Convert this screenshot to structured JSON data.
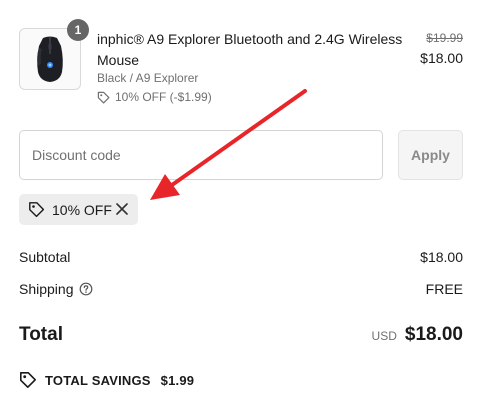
{
  "product": {
    "quantity": "1",
    "name": "inphic® A9 Explorer Bluetooth and 2.4G Wireless Mouse",
    "variant": "Black / A9 Explorer",
    "discount": "10% OFF (-$1.99)",
    "original_price": "$19.99",
    "price": "$18.00",
    "thumbnail_icon": "mouse-icon"
  },
  "discount_code": {
    "placeholder": "Discount code",
    "value": "",
    "apply_label": "Apply"
  },
  "applied_discount": {
    "label": "10% OFF",
    "tag_icon": "tag-icon",
    "remove_icon": "close-icon"
  },
  "summary": {
    "subtotal_label": "Subtotal",
    "subtotal_value": "$18.00",
    "shipping_label": "Shipping",
    "shipping_value": "FREE",
    "total_label": "Total",
    "currency": "USD",
    "total_value": "$18.00",
    "savings_label": "TOTAL SAVINGS",
    "savings_value": "$1.99"
  },
  "colors": {
    "annotation_arrow": "#e8262a",
    "chip_background": "#ededed",
    "badge": "#666666"
  }
}
